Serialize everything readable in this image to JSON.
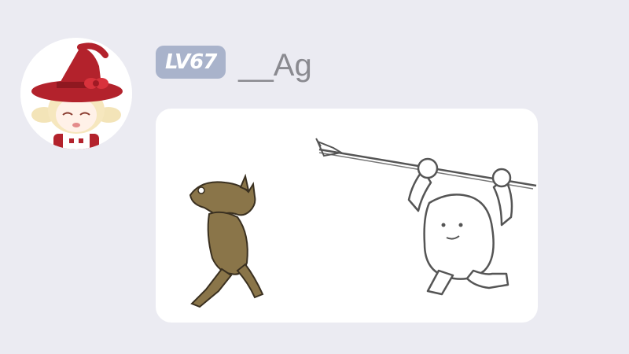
{
  "user": {
    "level_badge": "LV67",
    "username": "__Ag",
    "avatar_icon": "anime-witch-avatar-icon"
  },
  "message": {
    "type": "sticker",
    "sticker_icon": "stickman-chasing-horse-sticker"
  },
  "colors": {
    "background": "#ebebf2",
    "badge": "#a9b3cb",
    "username": "#8a8a90",
    "bubble": "#ffffff",
    "hat_red": "#b3222c",
    "horse_brown": "#8a7549"
  }
}
